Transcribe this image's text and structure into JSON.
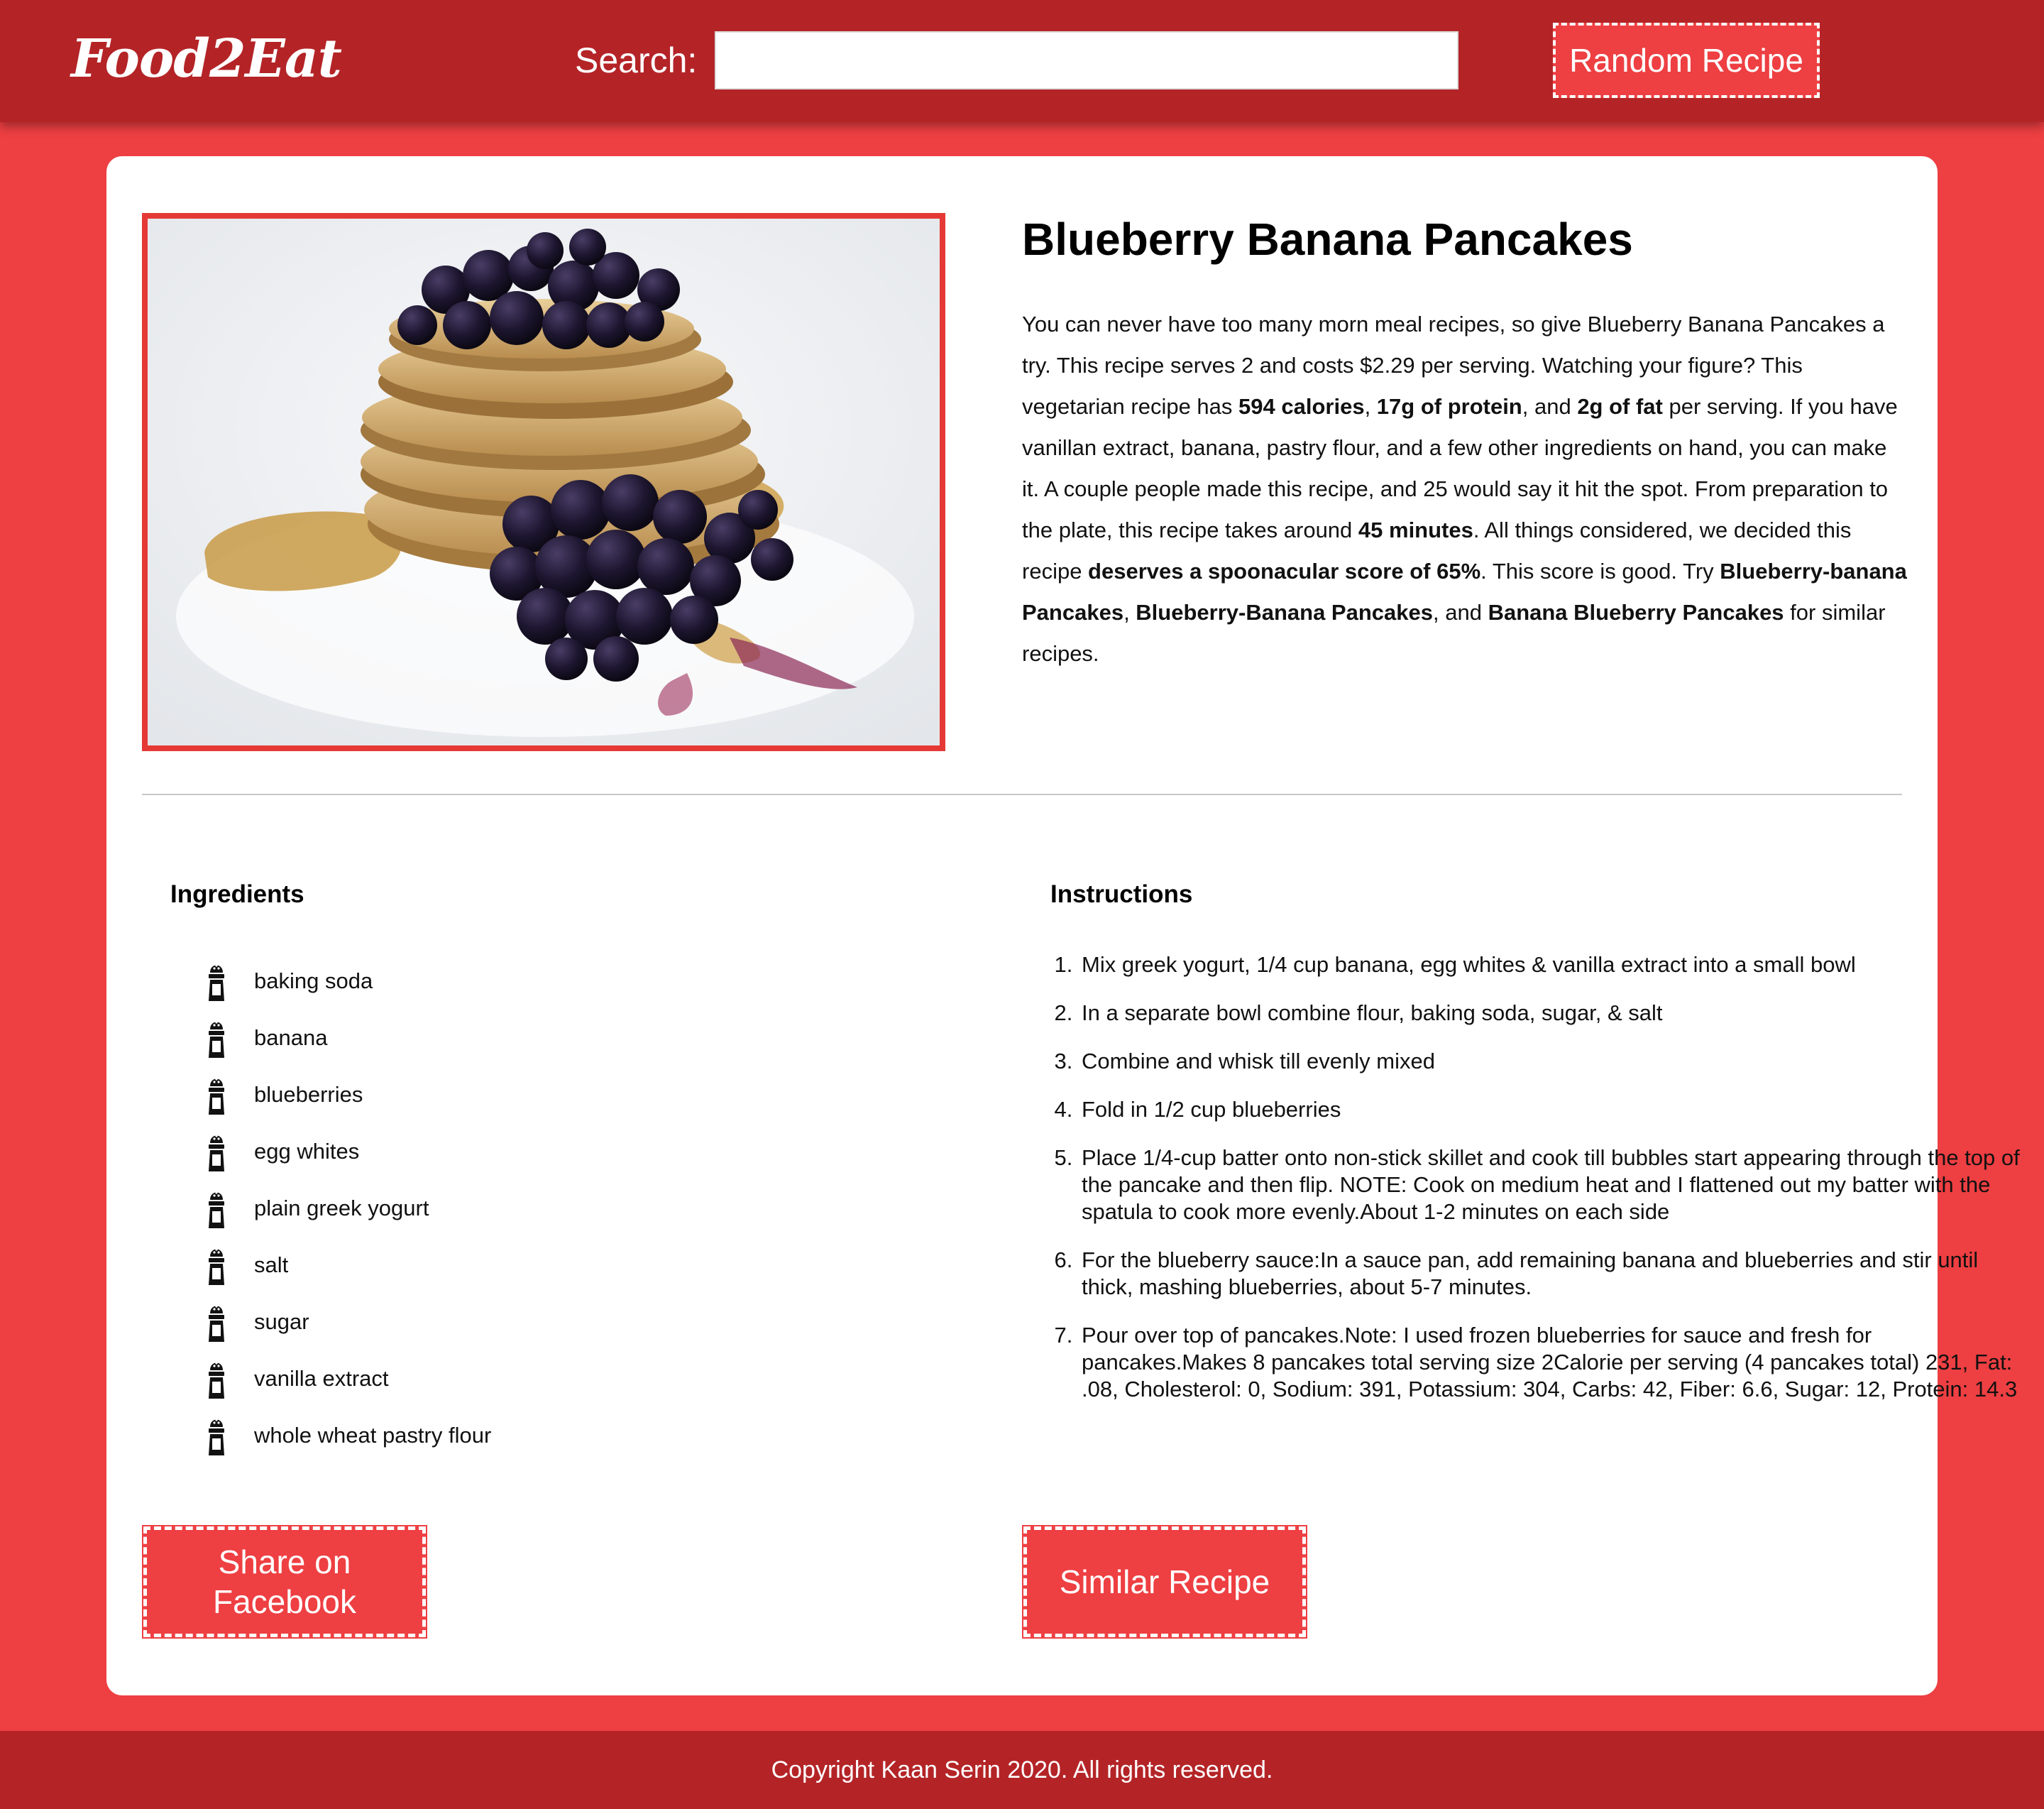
{
  "header": {
    "logo": "Food2Eat",
    "search_label": "Search:",
    "search_value": "",
    "search_placeholder": "",
    "random_button": "Random Recipe"
  },
  "recipe": {
    "title": "Blueberry Banana Pancakes",
    "summary": {
      "p1": "You can never have too many morn meal recipes, so give Blueberry Banana Pancakes a try. This recipe serves 2 and costs $2.29 per serving. Watching your figure? This vegetarian recipe has ",
      "calories": "594 calories",
      "sep1": ", ",
      "protein": "17g of protein",
      "sep2": ", and ",
      "fat": "2g of fat",
      "p2": " per serving. If you have vanillan extract, banana, pastry flour, and a few other ingredients on hand, you can make it. A couple people made this recipe, and 25 would say it hit the spot. From preparation to the plate, this recipe takes around ",
      "time": "45 minutes",
      "p3": ". All things considered, we decided this recipe ",
      "score": "deserves a spoonacular score of 65%",
      "p4": ". This score is good. Try ",
      "similar1": "Blueberry-banana Pancakes",
      "sep3": ", ",
      "similar2": "Blueberry-Banana Pancakes",
      "sep4": ", and ",
      "similar3": "Banana Blueberry Pancakes",
      "p5": " for similar recipes."
    },
    "ingredients_title": "Ingredients",
    "ingredients": [
      "baking soda",
      "banana",
      "blueberries",
      "egg whites",
      "plain greek yogurt",
      "salt",
      "sugar",
      "vanilla extract",
      "whole wheat pastry flour"
    ],
    "instructions_title": "Instructions",
    "instructions": [
      "Mix greek yogurt, 1/4 cup banana, egg whites & vanilla extract into a small bowl",
      "In a separate bowl combine flour, baking soda, sugar, & salt",
      "Combine and whisk till evenly mixed",
      "Fold in 1/2 cup blueberries",
      "Place 1/4-cup batter onto non-stick skillet and cook till bubbles start appearing through the top of the pancake and then flip. NOTE: Cook on medium heat and I flattened out my batter with the spatula to cook more evenly.About 1-2 minutes on each side",
      "For the blueberry sauce:In a sauce pan, add remaining banana and blueberries and stir until thick, mashing blueberries, about 5-7 minutes.",
      "Pour over top of pancakes.Note: I used frozen blueberries for sauce and fresh for pancakes.Makes 8 pancakes total serving size 2Calorie per serving (4 pancakes total) 231, Fat: .08, Cholesterol: 0, Sodium: 391, Potassium: 304, Carbs: 42, Fiber: 6.6, Sugar: 12, Protein: 14.3"
    ],
    "share_button": "Share on Facebook",
    "similar_button": "Similar Recipe"
  },
  "icons": {
    "ingredient": "salt-shaker-icon"
  },
  "colors": {
    "brand_red": "#ee3f42",
    "header_red": "#b42427",
    "photo_border": "#e53935"
  },
  "footer": {
    "copyright": "Copyright Kaan Serin 2020. All rights reserved."
  }
}
